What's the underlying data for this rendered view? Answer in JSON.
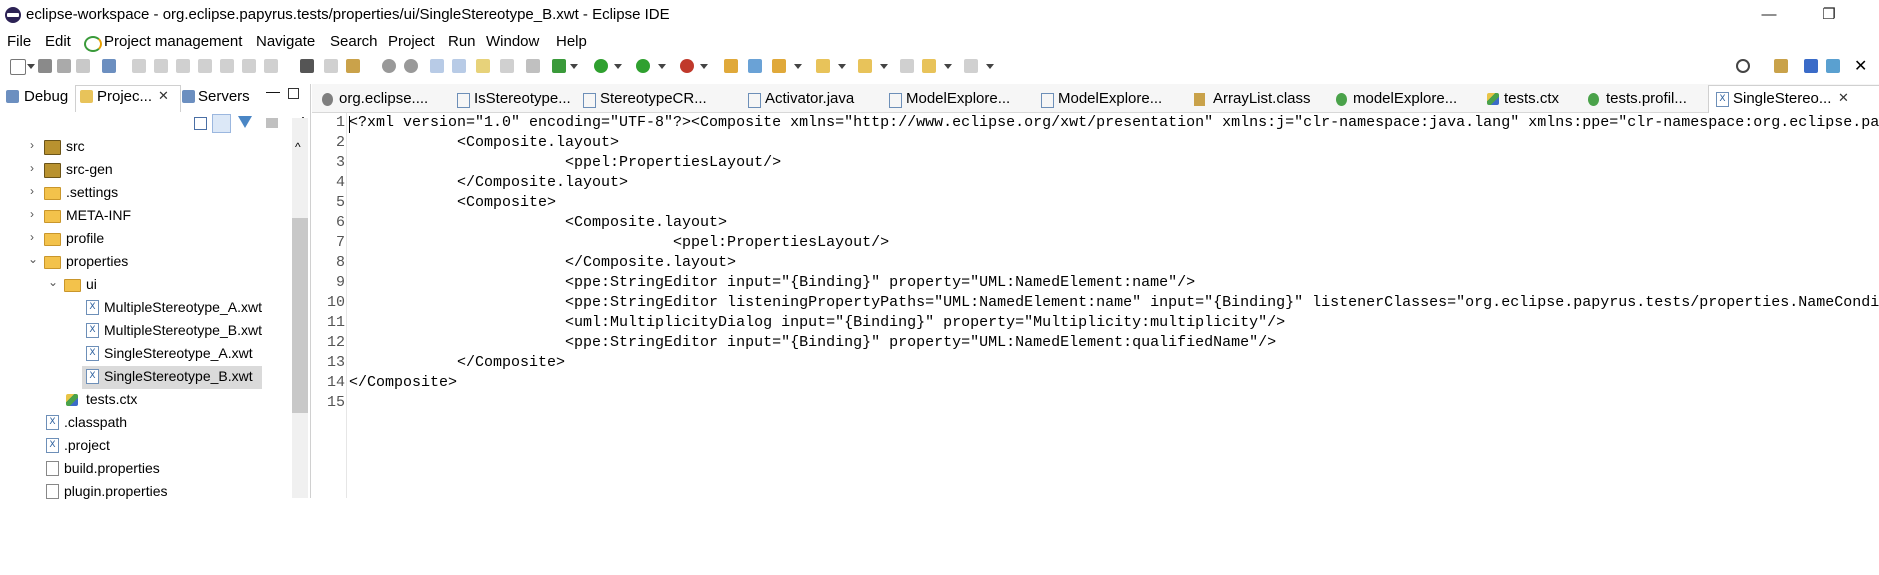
{
  "window": {
    "title": "eclipse-workspace - org.eclipse.papyrus.tests/properties/ui/SingleStereotype_B.xwt - Eclipse IDE",
    "minimize": "—",
    "restore": "❐"
  },
  "menu": [
    "File",
    "Edit",
    "Project management",
    "Navigate",
    "Search",
    "Project",
    "Run",
    "Window",
    "Help"
  ],
  "left_tabs": {
    "debug": "Debug",
    "project": "Projec...",
    "servers": "Servers"
  },
  "tree": [
    {
      "label": "src",
      "icon": "package-folder-icon",
      "expander": "collapsed"
    },
    {
      "label": "src-gen",
      "icon": "package-folder-icon",
      "expander": "collapsed"
    },
    {
      "label": ".settings",
      "icon": "folder-icon",
      "expander": "collapsed"
    },
    {
      "label": "META-INF",
      "icon": "folder-icon",
      "expander": "collapsed"
    },
    {
      "label": "profile",
      "icon": "folder-icon",
      "expander": "collapsed"
    },
    {
      "label": "properties",
      "icon": "folder-icon",
      "expander": "expanded"
    },
    {
      "label": "ui",
      "icon": "folder-icon",
      "expander": "expanded"
    },
    {
      "label": "MultipleStereotype_A.xwt",
      "icon": "xwt-file-icon"
    },
    {
      "label": "MultipleStereotype_B.xwt",
      "icon": "xwt-file-icon"
    },
    {
      "label": "SingleStereotype_A.xwt",
      "icon": "xwt-file-icon"
    },
    {
      "label": "SingleStereotype_B.xwt",
      "icon": "xwt-file-icon",
      "selected": true
    },
    {
      "label": "tests.ctx",
      "icon": "ctx-file-icon"
    },
    {
      "label": ".classpath",
      "icon": "xml-file-icon"
    },
    {
      "label": ".project",
      "icon": "xml-file-icon"
    },
    {
      "label": "build.properties",
      "icon": "properties-file-icon"
    },
    {
      "label": "plugin.properties",
      "icon": "properties-file-icon"
    }
  ],
  "editor_tabs": [
    "org.eclipse....",
    "IsStereotype...",
    "StereotypeCR...",
    "Activator.java",
    "ModelExplore...",
    "ModelExplore...",
    "ArrayList.class",
    "modelExplore...",
    "tests.ctx",
    "tests.profil...",
    "SingleStereo..."
  ],
  "editor_lines": [
    {
      "n": "1",
      "text": "<?xml version=\"1.0\" encoding=\"UTF-8\"?><Composite xmlns=\"http://www.eclipse.org/xwt/presentation\" xmlns:j=\"clr-namespace:java.lang\" xmlns:ppe=\"clr-namespace:org.eclipse.pa"
    },
    {
      "n": "2",
      "text": "            <Composite.layout>"
    },
    {
      "n": "3",
      "text": "                        <ppel:PropertiesLayout/>"
    },
    {
      "n": "4",
      "text": "            </Composite.layout>"
    },
    {
      "n": "5",
      "text": "            <Composite>"
    },
    {
      "n": "6",
      "text": "                        <Composite.layout>"
    },
    {
      "n": "7",
      "text": "                                    <ppel:PropertiesLayout/>"
    },
    {
      "n": "8",
      "text": "                        </Composite.layout>"
    },
    {
      "n": "9",
      "text": "                        <ppe:StringEditor input=\"{Binding}\" property=\"UML:NamedElement:name\"/>"
    },
    {
      "n": "10",
      "text": "                        <ppe:StringEditor listeningPropertyPaths=\"UML:NamedElement:name\" input=\"{Binding}\" listenerClasses=\"org.eclipse.papyrus.tests/properties.NameCondi"
    },
    {
      "n": "11",
      "text": "                        <uml:MultiplicityDialog input=\"{Binding}\" property=\"Multiplicity:multiplicity\"/>"
    },
    {
      "n": "12",
      "text": "                        <ppe:StringEditor input=\"{Binding}\" property=\"UML:NamedElement:qualifiedName\"/>"
    },
    {
      "n": "13",
      "text": "            </Composite>"
    },
    {
      "n": "14",
      "text": "</Composite>"
    },
    {
      "n": "15",
      "text": ""
    }
  ]
}
